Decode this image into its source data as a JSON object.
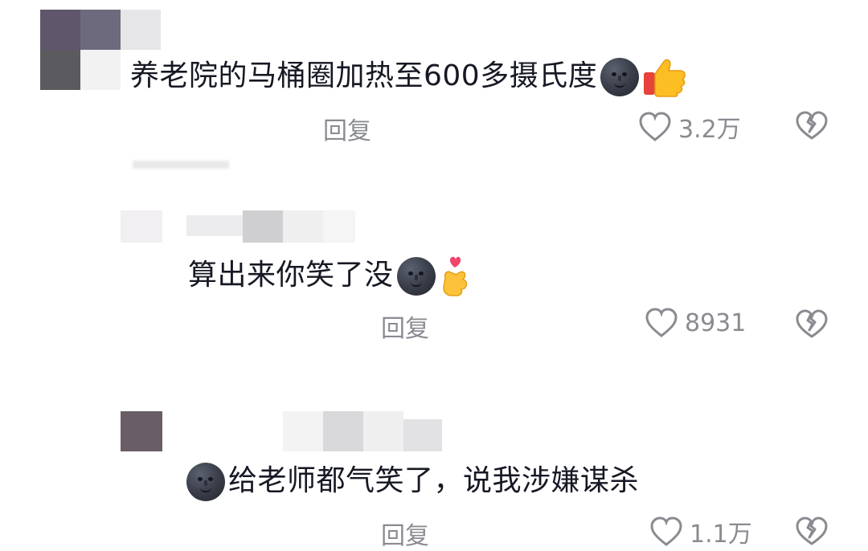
{
  "comments": [
    {
      "text": "养老院的马桶圈加热至600多摄氏度",
      "reply_label": "回复",
      "like_count": "3.2万",
      "emojis": [
        "new-moon-face",
        "thumbs-up"
      ]
    },
    {
      "text": "算出来你笑了没",
      "reply_label": "回复",
      "like_count": "8931",
      "emojis": [
        "new-moon-face",
        "finger-heart"
      ]
    },
    {
      "text": "给老师都气笑了，说我涉嫌谋杀",
      "reply_label": "回复",
      "like_count": "1.1万",
      "emojis": [
        "new-moon-face"
      ]
    }
  ],
  "colors": {
    "text": "#161823",
    "meta": "#8a8b91",
    "background": "#ffffff"
  },
  "icons": [
    "heart-outline-icon",
    "broken-heart-icon"
  ]
}
